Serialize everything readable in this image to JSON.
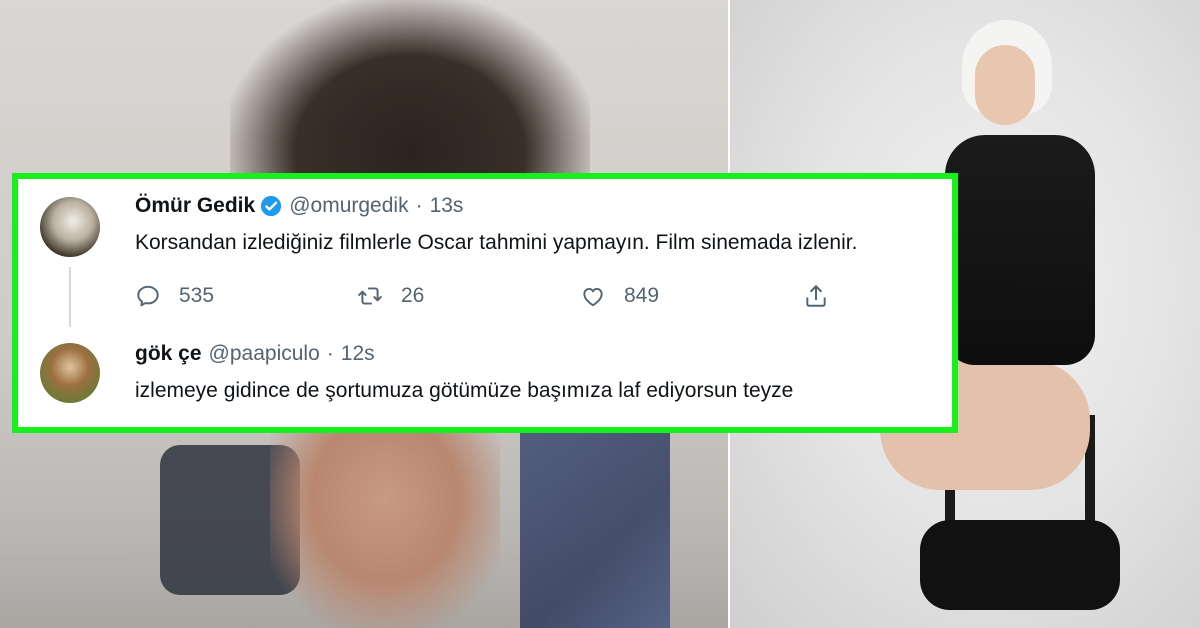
{
  "tweet_main": {
    "display_name": "Ömür Gedik",
    "handle": "@omurgedik",
    "separator": "·",
    "time": "13s",
    "text": "Korsandan izlediğiniz filmlerle Oscar tahmini yapmayın. Film sinemada izlenir.",
    "reply_count": "535",
    "retweet_count": "26",
    "like_count": "849",
    "verified": true
  },
  "tweet_reply": {
    "display_name": "gök çe",
    "handle": "@paapiculo",
    "separator": "·",
    "time": "12s",
    "text": "izlemeye gidince de şortumuza götümüze başımıza laf ediyorsun teyze"
  },
  "colors": {
    "frame_border": "#18f01e",
    "verified_badge": "#1d9bf0",
    "secondary_text": "#536471",
    "primary_text": "#0f1419"
  },
  "icons": [
    "reply-icon",
    "retweet-icon",
    "like-icon",
    "share-icon",
    "verified-badge-icon"
  ]
}
